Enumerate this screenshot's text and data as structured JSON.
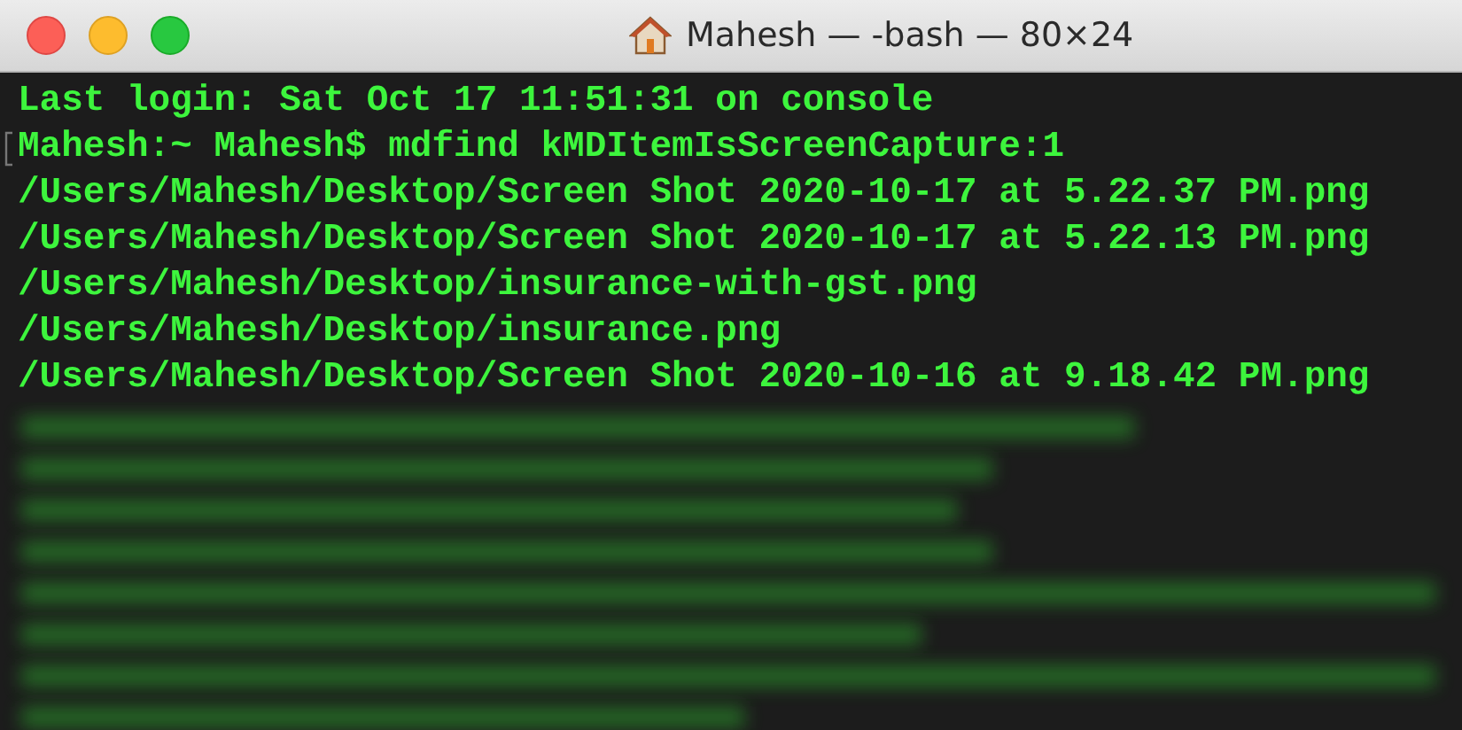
{
  "window": {
    "title": "Mahesh — -bash — 80×24"
  },
  "terminal": {
    "lines": [
      {
        "kind": "output",
        "text": "Last login: Sat Oct 17 11:51:31 on console"
      },
      {
        "kind": "prompt",
        "text": "Mahesh:~ Mahesh$ mdfind kMDItemIsScreenCapture:1"
      },
      {
        "kind": "output",
        "text": "/Users/Mahesh/Desktop/Screen Shot 2020-10-17 at 5.22.37 PM.png"
      },
      {
        "kind": "output",
        "text": "/Users/Mahesh/Desktop/Screen Shot 2020-10-17 at 5.22.13 PM.png"
      },
      {
        "kind": "output",
        "text": "/Users/Mahesh/Desktop/insurance-with-gst.png"
      },
      {
        "kind": "output",
        "text": "/Users/Mahesh/Desktop/insurance.png"
      },
      {
        "kind": "output",
        "text": "/Users/Mahesh/Desktop/Screen Shot 2020-10-16 at 9.18.42 PM.png"
      }
    ]
  }
}
